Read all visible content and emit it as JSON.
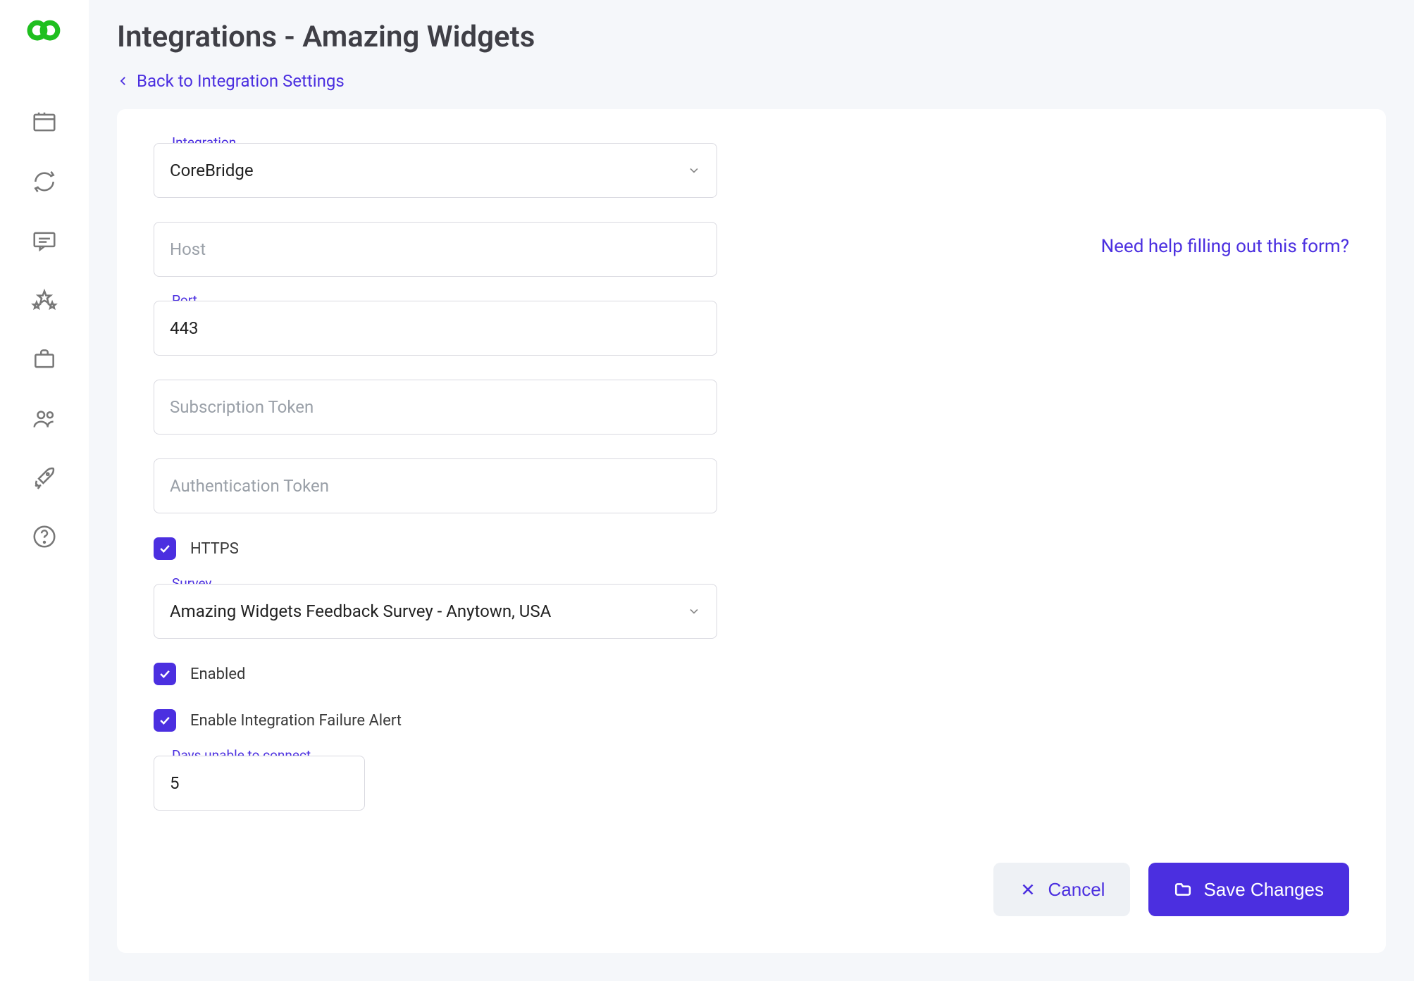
{
  "header": {
    "title": "Integrations - Amazing Widgets",
    "back_label": "Back to Integration Settings"
  },
  "help_link": "Need help filling out this form?",
  "form": {
    "integration": {
      "label": "Integration",
      "value": "CoreBridge"
    },
    "host": {
      "placeholder": "Host",
      "value": ""
    },
    "port": {
      "label": "Port",
      "value": "443"
    },
    "subscription_token": {
      "placeholder": "Subscription Token",
      "value": ""
    },
    "authentication_token": {
      "placeholder": "Authentication Token",
      "value": ""
    },
    "https": {
      "label": "HTTPS",
      "checked": true
    },
    "survey": {
      "label": "Survey",
      "value": "Amazing Widgets Feedback Survey - Anytown, USA"
    },
    "enabled": {
      "label": "Enabled",
      "checked": true
    },
    "failure_alert": {
      "label": "Enable Integration Failure Alert",
      "checked": true
    },
    "days_unable": {
      "label": "Days unable to connect",
      "value": "5"
    }
  },
  "actions": {
    "cancel": "Cancel",
    "save": "Save Changes"
  }
}
